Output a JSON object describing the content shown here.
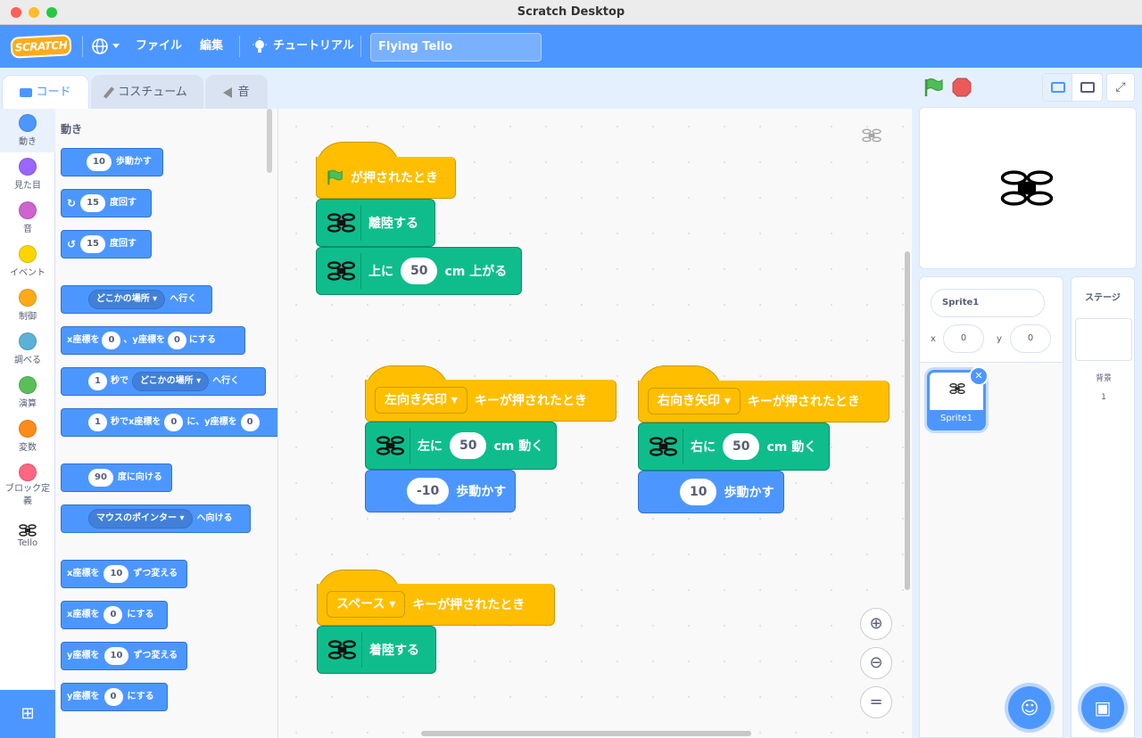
{
  "window": {
    "title": "Scratch Desktop"
  },
  "menu": {
    "file": "ファイル",
    "edit": "編集",
    "tutorials": "チュートリアル",
    "project_title": "Flying Tello",
    "logo": "SCRATCH"
  },
  "tabs": {
    "code": "コード",
    "costumes": "コスチューム",
    "sounds": "音"
  },
  "categories": [
    {
      "label": "動き",
      "color": "#4c97ff"
    },
    {
      "label": "見た目",
      "color": "#9966ff"
    },
    {
      "label": "音",
      "color": "#cf63cf"
    },
    {
      "label": "イベント",
      "color": "#ffd500"
    },
    {
      "label": "制御",
      "color": "#ffab19"
    },
    {
      "label": "調べる",
      "color": "#5cb1d6"
    },
    {
      "label": "演算",
      "color": "#59c059"
    },
    {
      "label": "変数",
      "color": "#ff8c1a"
    },
    {
      "label": "ブロック定義",
      "color": "#ff6680"
    },
    {
      "label": "Tello",
      "color": "#ffffff"
    }
  ],
  "palette": {
    "heading": "動き",
    "move_val": "10",
    "move_label": "歩動かす",
    "turn_right_val": "15",
    "turn_label": "度回す",
    "turn_left_val": "15",
    "goto_dd": "どこかの場所",
    "goto_label": "へ行く",
    "gotoxy_x_label": "x座標を",
    "gotoxy_x": "0",
    "gotoxy_y_label": "、y座標を",
    "gotoxy_y": "0",
    "gotoxy_end": "にする",
    "glide_sec": "1",
    "glide_label": "秒で",
    "glide_dd": "どこかの場所",
    "glide_end": "へ行く",
    "glidexy_sec": "1",
    "glidexy_label": "秒でx座標を",
    "glidexy_x": "0",
    "glidexy_mid": "に、y座標を",
    "glidexy_y": "0",
    "point_val": "90",
    "point_label": "度に向ける",
    "towards_dd": "マウスのポインター",
    "towards_label": "へ向ける",
    "changex_label": "x座標を",
    "changex_val": "10",
    "changex_end": "ずつ変える",
    "setx_label": "x座標を",
    "setx_val": "0",
    "setx_end": "にする",
    "changey_label": "y座標を",
    "changey_val": "10",
    "changey_end": "ずつ変える",
    "sety_label": "y座標を",
    "sety_val": "0",
    "sety_end": "にする"
  },
  "scripts": {
    "s1": {
      "hat": "が押されたとき",
      "takeoff": "離陸する",
      "up_pre": "上に",
      "up_val": "50",
      "up_post": "cm 上がる"
    },
    "s2": {
      "key": "左向き矢印",
      "hat": "キーが押されたとき",
      "left_pre": "左に",
      "left_val": "50",
      "left_post": "cm 動く",
      "move_val": "-10",
      "move_label": "歩動かす"
    },
    "s3": {
      "key": "右向き矢印",
      "hat": "キーが押されたとき",
      "right_pre": "右に",
      "right_val": "50",
      "right_post": "cm 動く",
      "move_val": "10",
      "move_label": "歩動かす"
    },
    "s4": {
      "key": "スペース",
      "hat": "キーが押されたとき",
      "land": "着陸する"
    }
  },
  "sprite": {
    "name": "Sprite1",
    "x_label": "x",
    "x": "0",
    "y_label": "y",
    "y": "0",
    "thumb_label": "Sprite1"
  },
  "stage_panel": {
    "title": "ステージ",
    "backdrop_label": "背景",
    "backdrop_count": "1"
  }
}
